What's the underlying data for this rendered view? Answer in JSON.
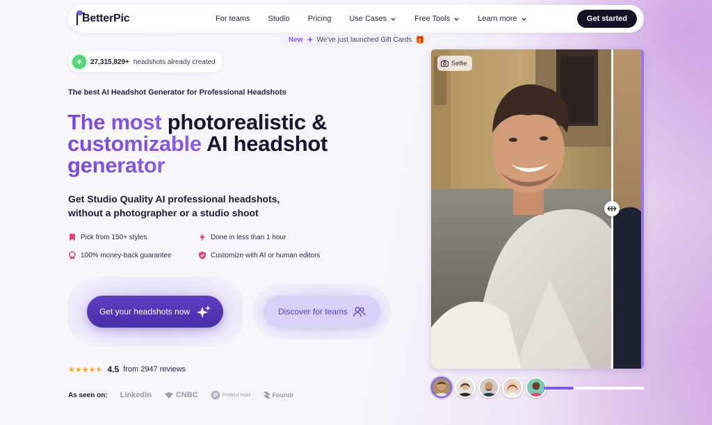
{
  "brand": {
    "name": "BetterPic",
    "accent": "#7b5be6",
    "dark": "#141224"
  },
  "nav": {
    "links": [
      {
        "label": "For teams",
        "dropdown": false
      },
      {
        "label": "Studio",
        "dropdown": false
      },
      {
        "label": "Pricing",
        "dropdown": false
      },
      {
        "label": "Use Cases",
        "dropdown": true
      },
      {
        "label": "Free Tools",
        "dropdown": true
      },
      {
        "label": "Learn more",
        "dropdown": true
      }
    ],
    "cta": "Get started"
  },
  "announcement": {
    "badge": "New",
    "text": "We've just launched Gift Cards",
    "icon": "gift-icon"
  },
  "counter": {
    "count": "27,315,829+",
    "text": "headshots already created",
    "icon": "plus-icon"
  },
  "hero": {
    "eyebrow": "The best AI Headshot Generator for Professional Headshots",
    "headline_l1a": "The most ",
    "headline_l1b": "photorealistic &",
    "headline_l2a": "customizable",
    "headline_l2b": " AI headshot",
    "headline_l3": "generator",
    "sub_l1": "Get Studio Quality AI professional headshots,",
    "sub_l2": "without a photographer or a studio shoot"
  },
  "features": [
    {
      "label": "Pick from 150+ styles",
      "icon": "bookmark-icon",
      "color": "#e0457a"
    },
    {
      "label": "Done in less than 1 hour",
      "icon": "lightning-icon",
      "color": "#e0457a"
    },
    {
      "label": "100% money-back guarantee",
      "icon": "badge-icon",
      "color": "#e0457a"
    },
    {
      "label": "Customize with AI or human editors",
      "icon": "shield-icon",
      "color": "#e0457a"
    }
  ],
  "buttons": {
    "primary": "Get your headshots now",
    "secondary": "Discover for teams"
  },
  "rating": {
    "stars": 4.5,
    "score": "4.5",
    "text": "from 2947 reviews"
  },
  "seen_on": {
    "label": "As seen on:",
    "outlets": [
      "LinkedIn",
      "CNBC",
      "Product Hunt",
      "Foundr"
    ]
  },
  "comparison": {
    "tag": "Selfie",
    "avatars_count": 5,
    "progress": 0.3
  }
}
